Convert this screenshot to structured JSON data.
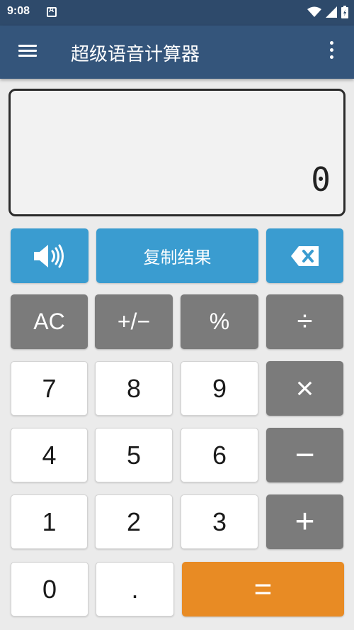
{
  "status_bar": {
    "time": "9:08"
  },
  "app_bar": {
    "title": "超级语音计算器"
  },
  "display": {
    "value": "0"
  },
  "action_row": {
    "copy_label": "复制结果"
  },
  "keypad": {
    "ac": "AC",
    "plus_minus": "+/−",
    "percent": "%",
    "divide": "÷",
    "multiply": "×",
    "minus": "−",
    "plus": "+",
    "equals": "=",
    "decimal": ".",
    "digits": {
      "d0": "0",
      "d1": "1",
      "d2": "2",
      "d3": "3",
      "d4": "4",
      "d5": "5",
      "d6": "6",
      "d7": "7",
      "d8": "8",
      "d9": "9"
    }
  },
  "colors": {
    "status_bar": "#2e4a6b",
    "app_bar": "#34557b",
    "blue_button": "#3a9cd0",
    "gray_button": "#7b7b7b",
    "equals_button": "#e88b24",
    "background": "#ebebeb"
  },
  "icons": [
    "menu-icon",
    "more-vert-icon",
    "speaker-icon",
    "backspace-icon",
    "wifi-icon",
    "signal-icon",
    "battery-icon",
    "notification-icon"
  ]
}
